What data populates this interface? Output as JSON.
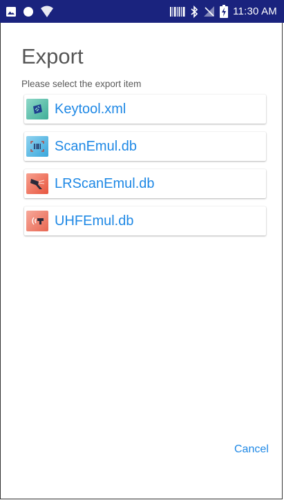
{
  "status_bar": {
    "time": "11:30 AM",
    "background": "#1a237e"
  },
  "dialog": {
    "title": "Export",
    "subtitle": "Please select the export item",
    "items": [
      {
        "label": "Keytool.xml",
        "icon": "keytool-icon"
      },
      {
        "label": "ScanEmul.db",
        "icon": "barcode-scan-icon"
      },
      {
        "label": "LRScanEmul.db",
        "icon": "lr-scanner-icon"
      },
      {
        "label": "UHFEmul.db",
        "icon": "uhf-rfid-icon"
      }
    ],
    "cancel_label": "Cancel",
    "accent_color": "#1e88e5"
  }
}
